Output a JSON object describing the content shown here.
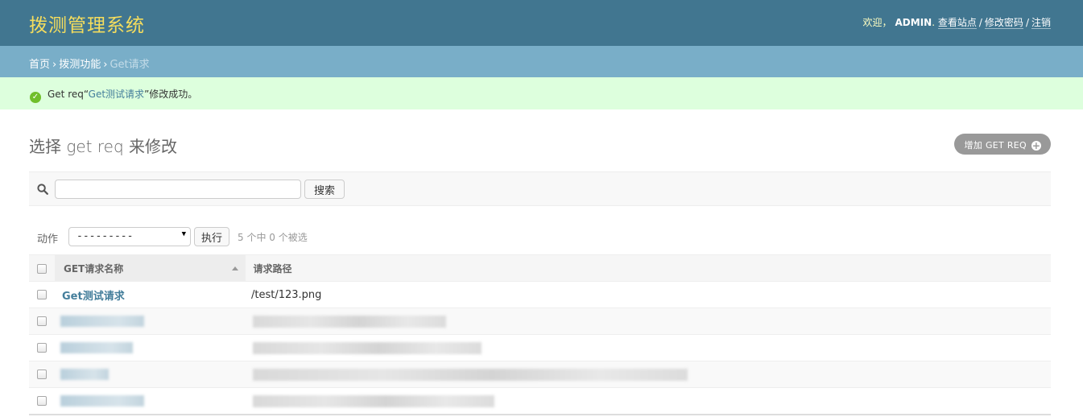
{
  "header": {
    "site_name": "拨测管理系统",
    "welcome": "欢迎，",
    "username": "ADMIN",
    "view_site": "查看站点",
    "change_password": "修改密码",
    "logout": "注销",
    "separator": "/"
  },
  "breadcrumbs": {
    "home": "首页",
    "app": "拨测功能",
    "current": "Get请求",
    "separator": "›"
  },
  "message": {
    "prefix": "Get req“",
    "link": "Get测试请求",
    "suffix": "”修改成功。"
  },
  "page": {
    "title": "选择 get req 来修改",
    "add_button": "增加 GET REQ"
  },
  "search": {
    "value": "",
    "button": "搜索"
  },
  "actions": {
    "label": "动作",
    "selected_option": "---------",
    "go_button": "执行",
    "counter": "5 个中 0 个被选"
  },
  "table": {
    "columns": [
      "GET请求名称",
      "请求路径"
    ],
    "sort_indicator": "ascending",
    "rows": [
      {
        "name": "Get测试请求",
        "path": "/test/123.png",
        "blurred": false
      },
      {
        "name": "",
        "path": "",
        "blurred": true
      },
      {
        "name": "",
        "path": "",
        "blurred": true
      },
      {
        "name": "",
        "path": "",
        "blurred": true
      },
      {
        "name": "",
        "path": "",
        "blurred": true
      }
    ]
  },
  "colors": {
    "header_bg": "#417690",
    "branding": "#f5dd5d",
    "breadcrumb_bg": "#79aec8",
    "success_bg": "#dddddd",
    "link": "#447e9b",
    "add_button_bg": "#999999"
  },
  "icons": {
    "success": "check-circle-icon",
    "search": "search-icon",
    "add": "plus-circle-icon",
    "sort": "sort-ascending-icon"
  }
}
